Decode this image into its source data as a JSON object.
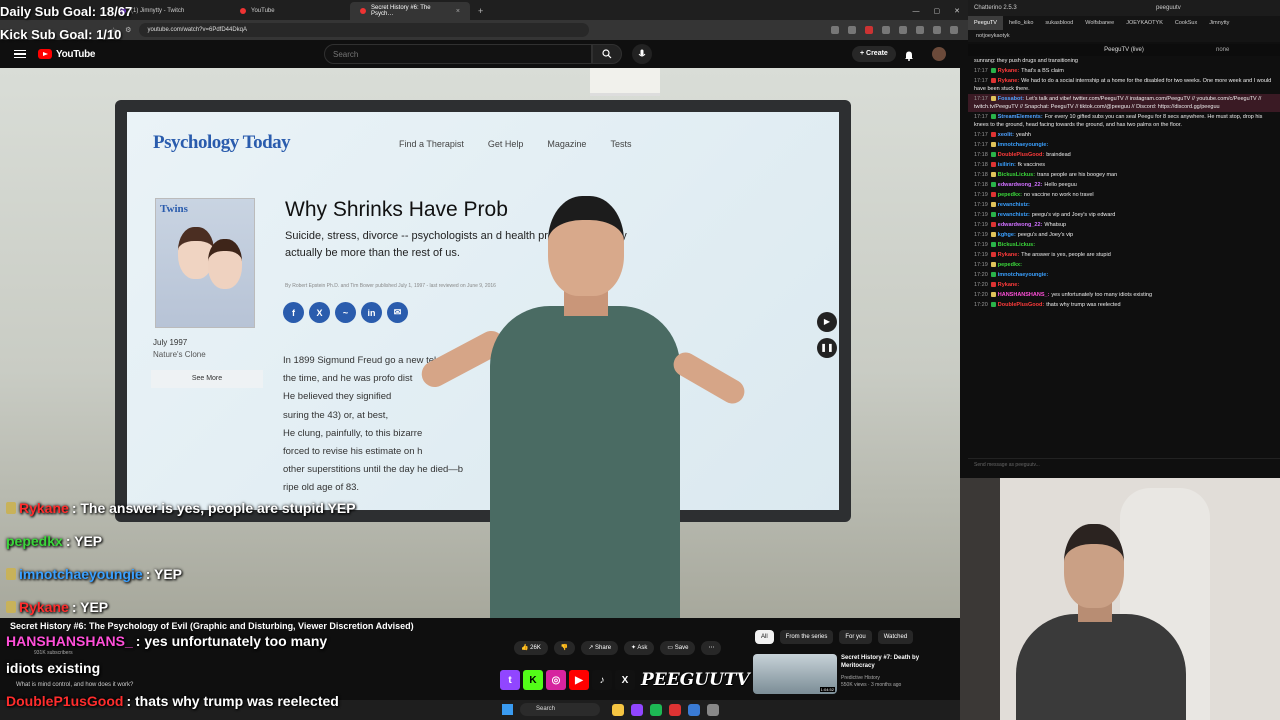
{
  "browser": {
    "tabs": [
      {
        "label": "(1) Jimnytty - Twitch",
        "icon": "twitch-favicon",
        "active": false
      },
      {
        "label": "YouTube",
        "icon": "youtube-favicon",
        "active": false
      },
      {
        "label": "Secret History #6: The Psych…",
        "icon": "youtube-favicon",
        "active": true
      }
    ],
    "new_tab": "+",
    "url": "youtube.com/watch?v=6PdfD44DkqA"
  },
  "stream_overlay": {
    "goal_line_1": "Daily Sub Goal: 18/67",
    "goal_line_2": "Kick Sub Goal: 1/10",
    "chat": [
      {
        "user": "Rykane",
        "text": " : The answer is yes, people are stupid YEP",
        "color": "#ff2d2d",
        "badge": true
      },
      {
        "user": "pepedkx",
        "text": " : YEP",
        "color": "#3bd63b",
        "badge": false
      },
      {
        "user": "imnotchaeyoungie",
        "text": " : YEP",
        "color": "#3aa0ff",
        "badge": true
      },
      {
        "user": "Rykane",
        "text": " : YEP",
        "color": "#ff2d2d",
        "badge": true
      },
      {
        "user": "HANSHANSHANS_",
        "text": " : yes unfortunately too many",
        "color": "#ff4fd8",
        "badge": false
      },
      {
        "user": "",
        "text": "idiots existing",
        "color": "#ffffff",
        "badge": false
      },
      {
        "user": "DoubleP1usGood",
        "text": " : thats why trump was reelected",
        "color": "#ff2d2d",
        "badge": false
      }
    ],
    "brand_tag": "PEEGUUTV"
  },
  "youtube": {
    "logo": "YouTube",
    "search_placeholder": "Search",
    "create_label": "+ Create",
    "video_title": "Secret History #6: The Psychology of Evil (Graphic and Disturbing, Viewer Discretion Advised)",
    "channel_subs": "931K subscribers",
    "desc_snippet": "What is mind control, and how does it work?",
    "actions": {
      "likes": "26K",
      "share": "Share",
      "ask": "Ask",
      "save": "Save",
      "more": "⋯"
    },
    "chips": [
      "All",
      "From the series",
      "For you",
      "Watched"
    ],
    "recommendation": {
      "title": "Secret History #7: Death by Meritocracy",
      "channel": "Predictive History",
      "meta": "550K views · 3 months ago",
      "duration": "1:04:52"
    }
  },
  "slide": {
    "site_logo": "Psychology Today",
    "nav": [
      "Find a Therapist",
      "Get Help",
      "Magazine",
      "Tests"
    ],
    "magazine_cover_text": "Twins",
    "issue_date": "July 1997",
    "issue_topic": "Nature's Clone",
    "see_more": "See More",
    "title": "Why Shrinks Have Prob",
    "subtitle": "Suicide, stress, divorce -- psychologists an d health professionals may actually be more than the rest of us.",
    "byline": "By Robert Epstein Ph.D. and Tim Bower published July 1, 1997 - last reviewed on June 9, 2016",
    "body": [
      "In 1899 Sigmund Freud go a new tel",
      "the time, and he was profo dist",
      "He believed they signified",
      "suring the 43) or, at best,",
      "He clung, painfully, to this bizarre ",
      "forced to revise his estimate on h",
      "other superstitions until the day he died—b",
      "ripe old age of 83."
    ]
  },
  "taskbar": {
    "search": "Search"
  },
  "chatterino": {
    "title": "Chatterino 2.5.3",
    "user": "peeguutv",
    "tabs": [
      "PeeguTV",
      "hello_kiko",
      "sukasblood",
      "Wolfsbanee",
      "JOEYKAOTYK",
      "CookSux",
      "Jimnytty"
    ],
    "tab2": "notjoeykaotyk",
    "channel_header": "PeeguTV (live)",
    "mode": "none",
    "messages": [
      {
        "time": "",
        "user": "",
        "text": "sunrang: they push drugs and transitioning",
        "color": "#c29be8",
        "hl": false
      },
      {
        "time": "17:17",
        "user": "Rykane:",
        "text": "That's a BS claim",
        "color": "#ff3b3b",
        "hl": false
      },
      {
        "time": "17:17",
        "user": "Rykane:",
        "text": "We had to do a social internship at a home for the disabled for two weeks. One more week and I would have been stuck there.",
        "color": "#ff3b3b",
        "hl": false
      },
      {
        "time": "17:17",
        "user": "Fossabot:",
        "text": "Let's talk and vibe! twitter.com/PeeguTV // instagram.com/PeeguTV // youtube.com/c/PeeguTV // twitch.tv/PeeguTV // Snapchat: PeeguTV // tiktok.com/@peeguu // Discord: https://discord.gg/peeguu",
        "color": "#4ea1ff",
        "hl": true
      },
      {
        "time": "17:17",
        "user": "StreamElements:",
        "text": "For every 10 gifted subs you can seal Peegu for 8 secs anywhere. He must stop, drop his knees to the ground, head facing towards the ground, and has two palms on the floor.",
        "color": "#4ea1ff",
        "hl": false
      },
      {
        "time": "17:17",
        "user": "xeolit:",
        "text": "yeahh",
        "color": "#4ea1ff",
        "hl": false
      },
      {
        "time": "17:17",
        "user": "imnotchaeyoungie:",
        "text": "",
        "color": "#3aa0ff",
        "hl": false
      },
      {
        "time": "17:18",
        "user": "DoublePlusGood:",
        "text": "braindead",
        "color": "#ff3b3b",
        "hl": false
      },
      {
        "time": "17:18",
        "user": "isilirin:",
        "text": "fk vaccines",
        "color": "#3aa0ff",
        "hl": false
      },
      {
        "time": "17:18",
        "user": "BickusLickus:",
        "text": "trans people are his boogey man",
        "color": "#3bd63b",
        "hl": false
      },
      {
        "time": "17:18",
        "user": "edwardwong_22:",
        "text": "Hello peeguu",
        "color": "#d070ff",
        "hl": false
      },
      {
        "time": "17:19",
        "user": "pepedkx:",
        "text": "no vaccine no work no travel",
        "color": "#3bd63b",
        "hl": false
      },
      {
        "time": "17:19",
        "user": "revanchistz:",
        "text": "",
        "color": "#3aa0ff",
        "hl": false
      },
      {
        "time": "17:19",
        "user": "revanchistz:",
        "text": "peegu's vip and Joey's vip edward",
        "color": "#3aa0ff",
        "hl": false
      },
      {
        "time": "17:19",
        "user": "edwardwong_22:",
        "text": "Whatsup",
        "color": "#d070ff",
        "hl": false
      },
      {
        "time": "17:19",
        "user": "kghge:",
        "text": "peegu's and Joey's vip",
        "color": "#3aa0ff",
        "hl": false
      },
      {
        "time": "17:19",
        "user": "BickusLickus:",
        "text": "",
        "color": "#3bd63b",
        "hl": false
      },
      {
        "time": "17:19",
        "user": "Rykane:",
        "text": "The answer is yes, people are stupid",
        "color": "#ff3b3b",
        "hl": false
      },
      {
        "time": "17:19",
        "user": "pepedkx:",
        "text": "",
        "color": "#3bd63b",
        "hl": false
      },
      {
        "time": "17:20",
        "user": "imnotchaeyoungie:",
        "text": "",
        "color": "#3aa0ff",
        "hl": false
      },
      {
        "time": "17:20",
        "user": "Rykane:",
        "text": "",
        "color": "#ff3b3b",
        "hl": false
      },
      {
        "time": "17:20",
        "user": "HANSHANSHANS_:",
        "text": "yes unfortunately too many idiots existing",
        "color": "#ff4fd8",
        "hl": false
      },
      {
        "time": "17:20",
        "user": "DoublePlusGood:",
        "text": "thats why trump was reelected",
        "color": "#ff3b3b",
        "hl": false
      }
    ],
    "input_placeholder": "Send message as peeguutv..."
  }
}
